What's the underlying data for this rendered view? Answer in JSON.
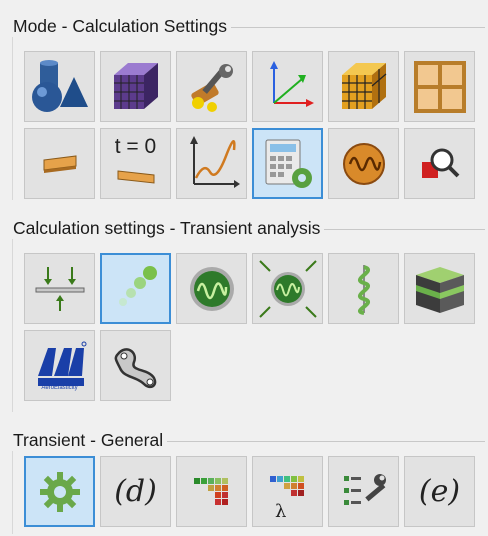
{
  "groups": [
    {
      "title": "Mode - Calculation Settings"
    },
    {
      "title": "Calculation settings - Transient analysis"
    },
    {
      "title": "Transient - General"
    }
  ],
  "buttons": {
    "t0_label": "t = 0",
    "d_label": "(d)",
    "e_label": "(e)",
    "lambda_label": "λ",
    "logo_text": "AeroElasticity"
  },
  "icons": [
    "geometry-shapes-icon",
    "mesh-cube-icon",
    "tools-icon",
    "axes-icon",
    "mesh-grid-cube-icon",
    "grid-panel-icon",
    "beam-icon",
    "initial-time-icon",
    "response-curve-icon",
    "calculator-settings-icon",
    "oscillation-icon",
    "zoom-inspect-icon",
    "supports-load-icon",
    "moving-particles-icon",
    "oscillator-icon",
    "oscillator-compress-icon",
    "spiral-icon",
    "layered-cube-icon",
    "aero-logo-icon",
    "structure-link-icon",
    "settings-gear-icon",
    "d-symbol-icon",
    "colormap-icon",
    "lambda-colormap-icon",
    "edit-tools-icon",
    "e-symbol-icon"
  ],
  "colors": {
    "active_bg": "#cce4f7",
    "active_border": "#3c8ed6",
    "button_bg": "#e2e2e2"
  }
}
